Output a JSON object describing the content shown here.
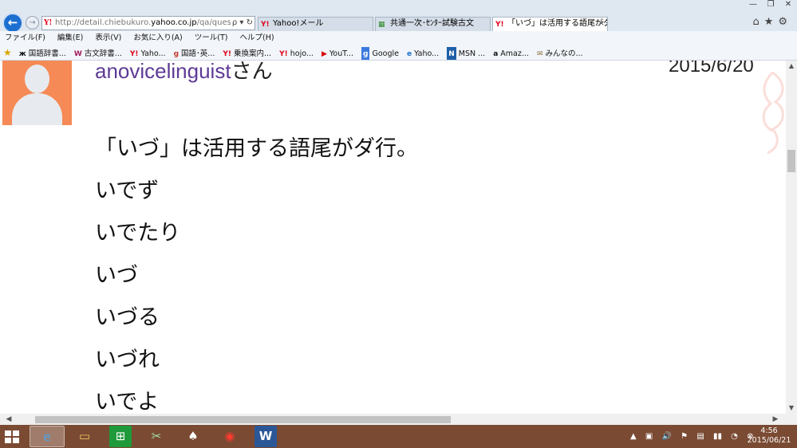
{
  "browser": {
    "address": {
      "prefix": "http://detail.chiebukuro.",
      "domain": "yahoo.co.jp",
      "suffix": "/qa/question_",
      "actions": "ρ ▾ ↻"
    },
    "tabs": [
      {
        "icon": "Y!",
        "label": "Yahoo!メール"
      },
      {
        "icon": "▦",
        "label": "共通一次･ｾﾝﾀｰ試験古文"
      },
      {
        "icon": "Y!",
        "label": "「いづ」は活用する語尾がダ行...",
        "close": "×"
      }
    ],
    "window_controls": [
      "—",
      "❐",
      "✕"
    ],
    "toolbar_icons": "⌂★⚙"
  },
  "menu": [
    "ファイル(F)",
    "編集(E)",
    "表示(V)",
    "お気に入り(A)",
    "ツール(T)",
    "ヘルプ(H)"
  ],
  "favorites": [
    {
      "icon": "ж",
      "label": "国語辞書..."
    },
    {
      "icon": "W",
      "label": "古文辞書..."
    },
    {
      "icon": "Y!",
      "label": "Yaho..."
    },
    {
      "icon": "g",
      "label": "国語･英..."
    },
    {
      "icon": "Y!",
      "label": "乗換案内..."
    },
    {
      "icon": "Y!",
      "label": "hojo..."
    },
    {
      "icon": "▶",
      "label": "YouT..."
    },
    {
      "icon": "g",
      "label": "Google"
    },
    {
      "icon": "e",
      "label": "Yaho..."
    },
    {
      "icon": "N",
      "label": "MSN ..."
    },
    {
      "icon": "a",
      "label": "Amaz..."
    },
    {
      "icon": "✉",
      "label": "みんなの..."
    }
  ],
  "answer": {
    "username": "anovicelinguist",
    "honorific": "さん",
    "date": "2015/6/20",
    "lines": [
      "「いづ」は活用する語尾がダ行。",
      "いでず",
      "いでたり",
      "いづ",
      "いづる",
      "いづれ",
      "いでよ"
    ]
  },
  "scrollbar": {
    "up": "▲",
    "down": "▼",
    "left": "◀",
    "right": "▶"
  },
  "taskbar": {
    "apps": [
      "e",
      "▭",
      "⊞",
      "✂",
      "♠",
      "◉",
      "W"
    ],
    "tray": [
      "▲",
      "▣",
      "🔊",
      "⚑",
      "▤",
      "▮▮",
      "◔",
      "⊗"
    ],
    "time": "4:56",
    "date": "2015/06/21"
  },
  "colors": {
    "username": "#5d3a95",
    "avatar": "#f58a56",
    "taskbar": "#7a4a33",
    "back_button": "#1c6fd0"
  }
}
